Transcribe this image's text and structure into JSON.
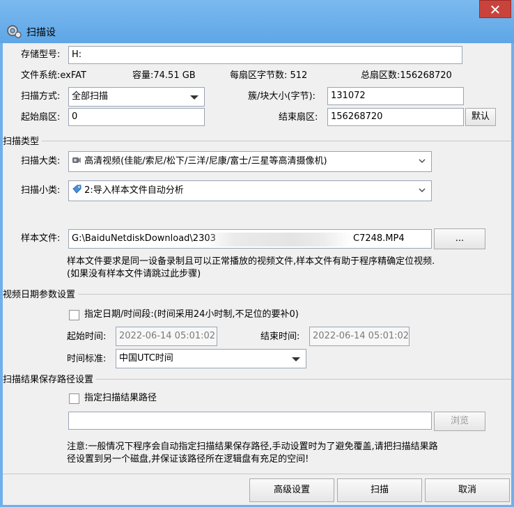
{
  "window": {
    "title": "扫描设",
    "close_glyph": "✕"
  },
  "device": {
    "model_label": "存储型号:",
    "model_value": "H:",
    "fs_text": "文件系统:exFAT",
    "capacity_text": "容量:74.51 GB",
    "sector_bytes_text": "每扇区字节数: 512",
    "total_sectors_text": "总扇区数:156268720",
    "scan_mode_label": "扫描方式:",
    "scan_mode_value": "全部扫描",
    "cluster_label": "簇/块大小(字节):",
    "cluster_value": "131072",
    "start_sector_label": "起始扇区:",
    "start_sector_value": "0",
    "end_sector_label": "结束扇区:",
    "end_sector_value": "156268720",
    "default_button": "默认"
  },
  "scan_type": {
    "section_title": "扫描类型",
    "major_label": "扫描大类:",
    "major_value": "高清视频(佳能/索尼/松下/三洋/尼康/富士/三星等高清摄像机)",
    "minor_label": "扫描小类:",
    "minor_value": "2:导入样本文件自动分析",
    "sample_label": "样本文件:",
    "sample_value_left": "G:\\BaiduNetdiskDownload\\2303",
    "sample_value_right": "C7248.MP4",
    "browse_button": "...",
    "note": "样本文件要求是同一设备录制且可以正常播放的视频文件,样本文件有助于程序精确定位视频.(如果没有样本文件请跳过此步骤)"
  },
  "date_params": {
    "section_title": "视频日期参数设置",
    "checkbox_label": "指定日期/时间段:(时间采用24小时制,不足位的要补0)",
    "start_label": "起始时间:",
    "start_value": "2022-06-14 05:01:02",
    "end_label": "结束时间:",
    "end_value": "2022-06-14 05:01:02",
    "tz_label": "时间标准:",
    "tz_value": "中国UTC时间"
  },
  "result_path": {
    "section_title": "扫描结果保存路径设置",
    "checkbox_label": "指定扫描结果路径",
    "path_value": "",
    "browse_button": "浏览",
    "note": "注意:一般情况下程序会自动指定扫描结果保存路径,手动设置时为了避免覆盖,请把扫描结果路径设置到另一个磁盘,并保证该路径所在逻辑盘有充足的空间!"
  },
  "actions": {
    "advanced": "高级设置",
    "scan": "扫描",
    "cancel": "取消"
  },
  "icons": {
    "app": "gear-scan-icon",
    "major": "camcorder-icon",
    "minor": "tag-icon",
    "dropdown": "chevron-down-icon"
  },
  "colors": {
    "titlebar": "#6fb0ea",
    "close": "#c9433c",
    "client": "#f0f0f0"
  }
}
